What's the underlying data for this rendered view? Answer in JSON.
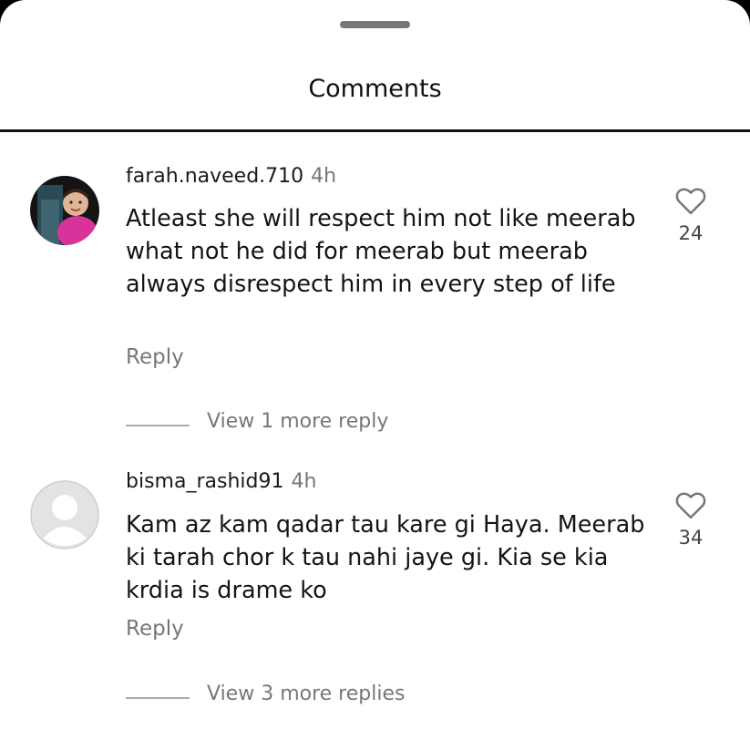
{
  "sheet": {
    "title": "Comments"
  },
  "icons": {
    "handle": "drag-handle",
    "like": "heart-outline-icon",
    "avatar_default": "default-user-avatar"
  },
  "comments": [
    {
      "username": "farah.naveed.710",
      "time": "4h",
      "text": "Atleast she will respect him not like meerab what not he did for meerab but meerab always disrespect him in every step of life",
      "reply_label": "Reply",
      "view_more": "View 1 more reply",
      "likes": "24",
      "avatar": "photo"
    },
    {
      "username": "bisma_rashid91",
      "time": "4h",
      "text": "Kam az kam qadar tau kare gi Haya. Meerab ki tarah chor k tau nahi jaye gi. Kia se kia krdia is drame ko",
      "reply_label": "Reply",
      "view_more": "View 3 more replies",
      "likes": "34",
      "avatar": "default"
    }
  ]
}
